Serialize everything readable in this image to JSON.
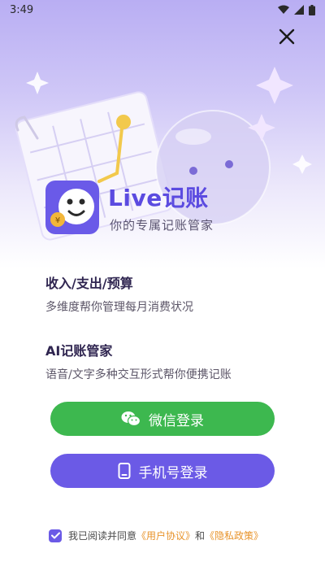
{
  "status_bar": {
    "time": "3:49"
  },
  "brand": {
    "name": "Live记账",
    "slogan": "你的专属记账管家"
  },
  "features": [
    {
      "title": "收入/支出/预算",
      "desc": "多维度帮你管理每月消费状况"
    },
    {
      "title": "AI记账管家",
      "desc": "语音/文字多种交互形式帮你便携记账"
    }
  ],
  "buttons": {
    "wechat_label": "微信登录",
    "phone_label": "手机号登录"
  },
  "agreement": {
    "prefix": "我已阅读并同意",
    "user_agreement": "《用户协议》",
    "joiner": "和",
    "privacy_policy": "《隐私政策》",
    "checked": true
  },
  "colors": {
    "accent": "#6b5ae6",
    "wechat_green": "#3db84f",
    "link_orange": "#e8932a"
  }
}
